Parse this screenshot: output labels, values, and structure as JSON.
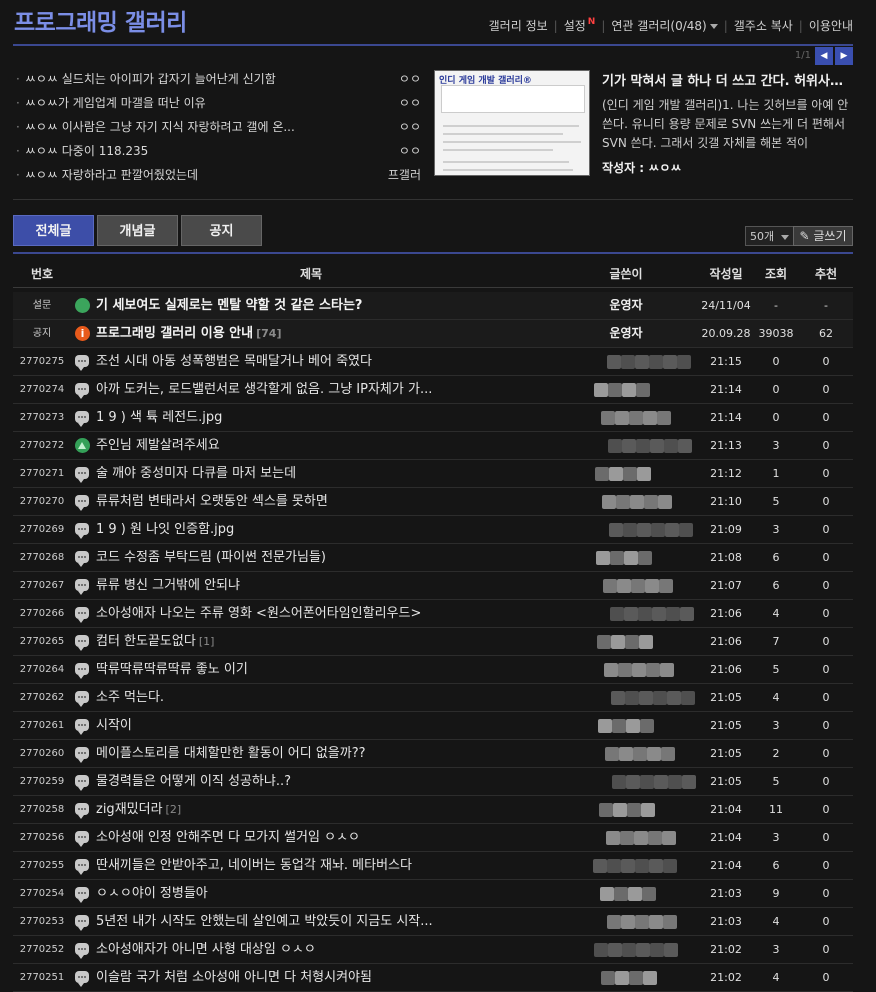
{
  "gallery": {
    "title": "프로그래밍 갤러리",
    "nav": [
      "갤러리 정보",
      "설정",
      "연관 갤러리(0/48)",
      "갤주소 복사",
      "이용안내"
    ],
    "new_badge": "N",
    "page_indicator": "1/1",
    "prev_icon": "chevron-left-icon",
    "next_icon": "chevron-right-icon"
  },
  "hot_posts": [
    {
      "text": "ㅆㅇㅆ 실드치는 아이피가 갑자기 늘어난게 신기함",
      "source": "ㅇㅇ"
    },
    {
      "text": "ㅆㅇㅆ가 게임업계 마갤을 떠난 이유",
      "source": "ㅇㅇ"
    },
    {
      "text": "ㅆㅇㅆ 이사람은 그냥 자기 지식 자랑하려고 갤에 온...",
      "source": "ㅇㅇ"
    },
    {
      "text": "ㅆㅇㅆ 다중이 118.235",
      "source": "ㅇㅇ"
    },
    {
      "text": "ㅆㅇㅆ 자랑하라고 판깔어줬었는데",
      "source": "프갤러"
    }
  ],
  "featured": {
    "thumb_title": "인디 게임 개발 갤러리®",
    "title": "기가 막혀서 글 하나 더 쓰고 간다. 허위사실...",
    "body": "(인디 게임 개발 갤러리)1. 나는 깃허브를 아예 안쓴다. 유니티 용량 문제로 SVN 쓰는게 더 편해서 SVN 쓴다. 그래서 깃갤 자체를 해본 적이",
    "author_label": "작성자 : ㅆㅇㅆ"
  },
  "tabs": [
    "전체글",
    "개념글",
    "공지"
  ],
  "list_controls": {
    "page_size": "50개",
    "write_label": "글쓰기",
    "write_icon": "pencil-icon"
  },
  "columns": [
    "번호",
    "제목",
    "글쓴이",
    "작성일",
    "조회",
    "추천"
  ],
  "rows": [
    {
      "no": "설문",
      "icon": "megaphone-icon",
      "title": "기 세보여도 실제로는 멘탈 약할 것 같은 스타는?",
      "count": "",
      "writer": "운영자",
      "date": "24/11/04",
      "views": "-",
      "rec": "-",
      "notice": true
    },
    {
      "no": "공지",
      "icon": "info-icon",
      "title": "프로그래밍 갤러리 이용 안내",
      "count": "[74]",
      "writer": "운영자",
      "date": "20.09.28",
      "views": "39038",
      "rec": "62",
      "notice": true
    },
    {
      "no": "2770275",
      "icon": "speech-icon",
      "title": "조선 시대 아동 성폭행범은 목매달거나 베어 죽였다",
      "count": "",
      "writer": "",
      "date": "21:15",
      "views": "0",
      "rec": "0"
    },
    {
      "no": "2770274",
      "icon": "speech-icon",
      "title": "아까 도커는, 로드밸런서로 생각할게 없음. 그냥 IP자체가 가...",
      "count": "",
      "writer": "",
      "date": "21:14",
      "views": "0",
      "rec": "0"
    },
    {
      "no": "2770273",
      "icon": "speech-icon",
      "title": "1 9 ) 색 튝 레전드.jpg",
      "count": "",
      "writer": "",
      "date": "21:14",
      "views": "0",
      "rec": "0"
    },
    {
      "no": "2770272",
      "icon": "picture-icon",
      "title": "주인님 제발살려주세요",
      "count": "",
      "writer": "",
      "date": "21:13",
      "views": "3",
      "rec": "0"
    },
    {
      "no": "2770271",
      "icon": "speech-icon",
      "title": "술 깨야 중성미자 다큐를 마저 보는데",
      "count": "",
      "writer": "",
      "date": "21:12",
      "views": "1",
      "rec": "0"
    },
    {
      "no": "2770270",
      "icon": "speech-icon",
      "title": "류류처럼 변태라서 오랫동안 섹스를 못하면",
      "count": "",
      "writer": "",
      "date": "21:10",
      "views": "5",
      "rec": "0"
    },
    {
      "no": "2770269",
      "icon": "speech-icon",
      "title": "1 9 ) 원 나잇 인증함.jpg",
      "count": "",
      "writer": "",
      "date": "21:09",
      "views": "3",
      "rec": "0"
    },
    {
      "no": "2770268",
      "icon": "speech-icon",
      "title": "코드 수정좀 부탁드림 (파이썬 전문가님들)",
      "count": "",
      "writer": "",
      "date": "21:08",
      "views": "6",
      "rec": "0"
    },
    {
      "no": "2770267",
      "icon": "speech-icon",
      "title": "류류 병신 그거밖에 안되냐",
      "count": "",
      "writer": "",
      "date": "21:07",
      "views": "6",
      "rec": "0"
    },
    {
      "no": "2770266",
      "icon": "speech-icon",
      "title": "소아성애자 나오는 주류 영화 <원스어폰어타임인할리우드>",
      "count": "",
      "writer": "",
      "date": "21:06",
      "views": "4",
      "rec": "0"
    },
    {
      "no": "2770265",
      "icon": "speech-icon",
      "title": "컴터 한도끝도없다",
      "count": "[1]",
      "writer": "",
      "date": "21:06",
      "views": "7",
      "rec": "0"
    },
    {
      "no": "2770264",
      "icon": "speech-icon",
      "title": "딱류딱류딱류딱류 좋노 이기",
      "count": "",
      "writer": "",
      "date": "21:06",
      "views": "5",
      "rec": "0"
    },
    {
      "no": "2770262",
      "icon": "speech-icon",
      "title": "소주 먹는다.",
      "count": "",
      "writer": "",
      "date": "21:05",
      "views": "4",
      "rec": "0"
    },
    {
      "no": "2770261",
      "icon": "speech-icon",
      "title": "시작이",
      "count": "",
      "writer": "",
      "date": "21:05",
      "views": "3",
      "rec": "0"
    },
    {
      "no": "2770260",
      "icon": "speech-icon",
      "title": "메이플스토리를 대체할만한 활동이 어디 없을까??",
      "count": "",
      "writer": "",
      "date": "21:05",
      "views": "2",
      "rec": "0"
    },
    {
      "no": "2770259",
      "icon": "speech-icon",
      "title": "물경력들은 어떻게 이직 성공하냐..?",
      "count": "",
      "writer": "",
      "date": "21:05",
      "views": "5",
      "rec": "0"
    },
    {
      "no": "2770258",
      "icon": "speech-icon",
      "title": "zig재밌더라",
      "count": "[2]",
      "writer": "",
      "date": "21:04",
      "views": "11",
      "rec": "0"
    },
    {
      "no": "2770256",
      "icon": "speech-icon",
      "title": "소아성애 인정 안해주면 다 모가지 썰거임 ㅇㅅㅇ",
      "count": "",
      "writer": "",
      "date": "21:04",
      "views": "3",
      "rec": "0"
    },
    {
      "no": "2770255",
      "icon": "speech-icon",
      "title": "딴새끼들은 안받아주고, 네이버는 동업각 재놔. 메타버스다",
      "count": "",
      "writer": "",
      "date": "21:04",
      "views": "6",
      "rec": "0"
    },
    {
      "no": "2770254",
      "icon": "speech-icon",
      "title": "ㅇㅅㅇ야이 정병들아",
      "count": "",
      "writer": "",
      "date": "21:03",
      "views": "9",
      "rec": "0"
    },
    {
      "no": "2770253",
      "icon": "speech-icon",
      "title": "5년전 내가 시작도 안했는데 살인예고 박았듯이 지금도 시작...",
      "count": "",
      "writer": "",
      "date": "21:03",
      "views": "4",
      "rec": "0"
    },
    {
      "no": "2770252",
      "icon": "speech-icon",
      "title": "소아성애자가 아니면 사형 대상임 ㅇㅅㅇ",
      "count": "",
      "writer": "",
      "date": "21:02",
      "views": "3",
      "rec": "0"
    },
    {
      "no": "2770251",
      "icon": "speech-icon",
      "title": "이슬람 국가 처럼 소아성애 아니면 다 처형시켜야됨",
      "count": "",
      "writer": "",
      "date": "21:02",
      "views": "4",
      "rec": "0"
    }
  ]
}
